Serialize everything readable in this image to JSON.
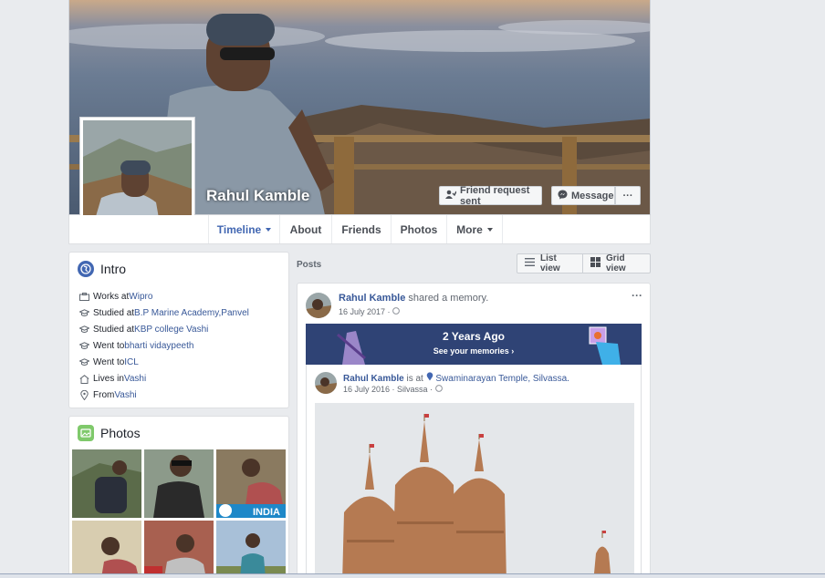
{
  "profile": {
    "name": "Rahul Kamble",
    "friend_request_label": "Friend request sent",
    "message_label": "Message",
    "more_label": "···"
  },
  "nav": {
    "tabs": [
      {
        "label": "Timeline",
        "has_caret": true
      },
      {
        "label": "About"
      },
      {
        "label": "Friends"
      },
      {
        "label": "Photos"
      },
      {
        "label": "More",
        "has_caret": true
      }
    ]
  },
  "intro": {
    "title": "Intro",
    "items": [
      {
        "icon": "briefcase-icon",
        "prefix": "Works at ",
        "link": "Wipro"
      },
      {
        "icon": "graduation-cap-icon",
        "prefix": "Studied at ",
        "link": "B.P Marine Academy,Panvel"
      },
      {
        "icon": "graduation-cap-icon",
        "prefix": "Studied at ",
        "link": "KBP college Vashi"
      },
      {
        "icon": "graduation-cap-icon",
        "prefix": "Went to ",
        "link": "bharti vidaypeeth"
      },
      {
        "icon": "graduation-cap-icon",
        "prefix": "Went to ",
        "link": "ICL"
      },
      {
        "icon": "home-icon",
        "prefix": "Lives in ",
        "link": "Vashi"
      },
      {
        "icon": "location-pin-icon",
        "prefix": "From ",
        "link": "Vashi"
      }
    ]
  },
  "photos": {
    "title": "Photos",
    "badge_text": "INDIA"
  },
  "posts": {
    "label": "Posts",
    "list_view": "List view",
    "grid_view": "Grid view",
    "post": {
      "author": "Rahul Kamble",
      "action": " shared a memory.",
      "date": "16 July 2017 ·",
      "options": "···",
      "memory": {
        "title": "2 Years Ago",
        "link": "See your memories ›"
      },
      "shared": {
        "author": "Rahul Kamble",
        "is_at": " is at ",
        "place": "Swaminarayan Temple, Silvassa.",
        "date": "16 July 2016 · Silvassa ·"
      }
    }
  },
  "colors": {
    "link": "#385898",
    "active_tab": "#4267b2",
    "memory_banner": "#2f4375"
  }
}
